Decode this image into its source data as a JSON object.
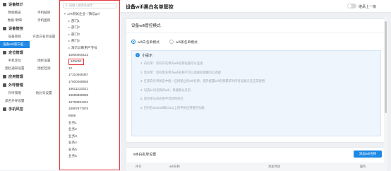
{
  "sidebar": {
    "sections": [
      {
        "title": "设备统计",
        "rows": [
          [
            "数据概览",
            "手机截屏"
          ],
          [
            "数据-明细",
            "手机图照"
          ]
        ]
      },
      {
        "title": "设备管控",
        "rows": [
          [
            "设备管控",
            "许黑白名单设置"
          ],
          [
            "设备wifi黑白名...",
            ""
          ]
        ]
      },
      {
        "title": "定位管理",
        "rows": [
          [
            "手机定位",
            "围栏设置"
          ],
          [
            "围栏通知设置",
            "围栏检测"
          ]
        ]
      },
      {
        "title": "应用管理",
        "rows": []
      },
      {
        "title": "外呼管理",
        "rows": [
          [
            "外呼策略",
            "防封号设置"
          ],
          [
            "黑名外呼设置",
            ""
          ]
        ]
      },
      {
        "title": "手机风控",
        "rows": []
      }
    ]
  },
  "tree": {
    "search_placeholder": "请输入搜索关键字",
    "items": [
      {
        "label": "176测试企业（微信ge）",
        "level": 0,
        "tri": "▾"
      },
      {
        "label": "部门1",
        "level": 1,
        "tri": "▸"
      },
      {
        "label": "部门2",
        "level": 1,
        "tri": "▸"
      },
      {
        "label": "部门3",
        "level": 1,
        "tri": "▸"
      },
      {
        "label": "部门4",
        "level": 1,
        "tri": "▸"
      },
      {
        "label": "演示诊断用户专号",
        "level": 1,
        "tri": "▸"
      },
      {
        "label": "15000000122",
        "level": 1,
        "tri": ""
      },
      {
        "label": "10W3G",
        "level": 1,
        "tri": "",
        "selected": true
      },
      {
        "label": "12",
        "level": 1,
        "tri": ""
      },
      {
        "label": "17310666387",
        "level": 1,
        "tri": ""
      },
      {
        "label": "17600469655",
        "level": 1,
        "tri": ""
      },
      {
        "label": "18611233321",
        "level": 1,
        "tri": ""
      },
      {
        "label": "18688889999",
        "level": 1,
        "tri": ""
      },
      {
        "label": "18708891231",
        "level": 1,
        "tri": ""
      },
      {
        "label": "18987877875",
        "level": 1,
        "tri": ""
      },
      {
        "label": "8888",
        "level": 1,
        "tri": ""
      },
      {
        "label": "业务1",
        "level": 1,
        "tri": ""
      },
      {
        "label": "业务2",
        "level": 1,
        "tri": ""
      },
      {
        "label": "业务3",
        "level": 1,
        "tri": ""
      },
      {
        "label": "业务4",
        "level": 1,
        "tri": ""
      },
      {
        "label": "业务5",
        "level": 1,
        "tri": ""
      },
      {
        "label": "业务6",
        "level": 1,
        "tri": ""
      }
    ]
  },
  "header": {
    "title": "设备wifi黑白名单管控",
    "toggle_label": "继承上一级"
  },
  "wifi_mode": {
    "title": "设备wifi管控模式",
    "options": [
      {
        "label": "wifi白名单模式",
        "checked": true
      },
      {
        "label": "wifi黑名单模式",
        "checked": false
      }
    ]
  },
  "tips": {
    "title": "小提示",
    "lines": [
      "1. 白名单：仅有白名单内wifi名称设备可以连接",
      "2. 黑名单：仅有黑名单内wifi名称不可以连接其他都可以连接",
      "3. 在黑白名单状态中统一应用禁止的wifi名称，提升配置wifi名称需求对所有设备无法正常使用",
      "4. 勾选公司名称内wifi，系统默认开启",
      "5. 黑名单与白名单不可同时开启",
      "6. 已开启android和iOS以上的手机应用管控功能"
    ]
  },
  "whitelist": {
    "title": "wifi白名单设置",
    "add_button": "添加wifi名称",
    "columns": [
      "序号",
      "wifi名称",
      "添加时间",
      "操作"
    ]
  }
}
